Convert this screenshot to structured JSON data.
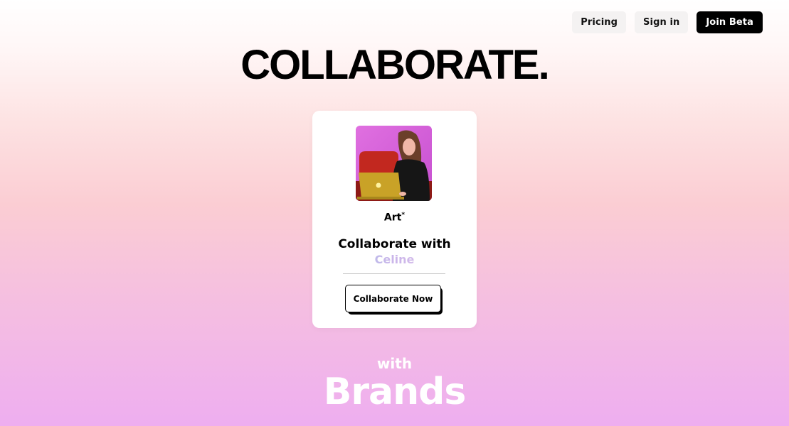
{
  "nav": {
    "pricing_label": "Pricing",
    "signin_label": "Sign in",
    "join_label": "Join Beta"
  },
  "hero": {
    "headline": "COLLABORATE."
  },
  "card": {
    "category": "Art",
    "category_mark": "*",
    "title": "Collaborate with",
    "name": "Celine",
    "cta_label": "Collaborate Now"
  },
  "footer": {
    "with": "with",
    "brands": "Brands"
  },
  "colors": {
    "primary_button": "#000000",
    "secondary_button": "#f4f2f2",
    "gradient_top": "#ffffff",
    "gradient_bottom": "#eeaef0"
  }
}
